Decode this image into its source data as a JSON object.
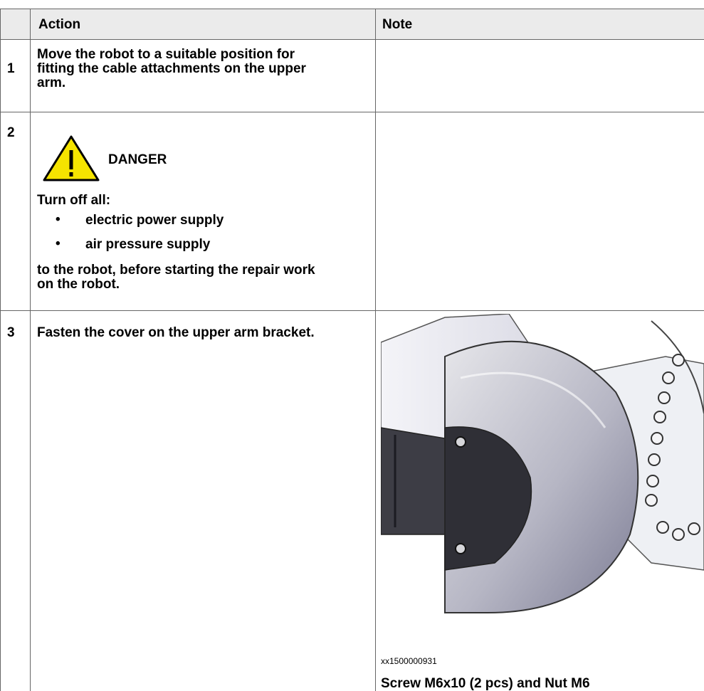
{
  "table": {
    "headers": {
      "blank": "",
      "action": "Action",
      "note": "Note"
    },
    "rows": [
      {
        "num": "1",
        "action_lines": [
          "Move the robot to a suitable position for",
          "fitting the cable attachments on the upper",
          "arm."
        ]
      },
      {
        "num": "2",
        "danger_label": "DANGER",
        "turn_off": "Turn off all:",
        "bullets": [
          "electric power supply",
          "air pressure supply"
        ],
        "after_lines": [
          "to the robot, before starting the repair work",
          "on the robot."
        ]
      },
      {
        "num": "3",
        "action": "Fasten the cover on the upper arm bracket.",
        "figure_id": "xx1500000931",
        "note": "Screw M6x10 (2 pcs) and Nut M6"
      }
    ]
  },
  "icons": {
    "warning": "warning-triangle-icon",
    "warning_fill": "#f5e400"
  }
}
